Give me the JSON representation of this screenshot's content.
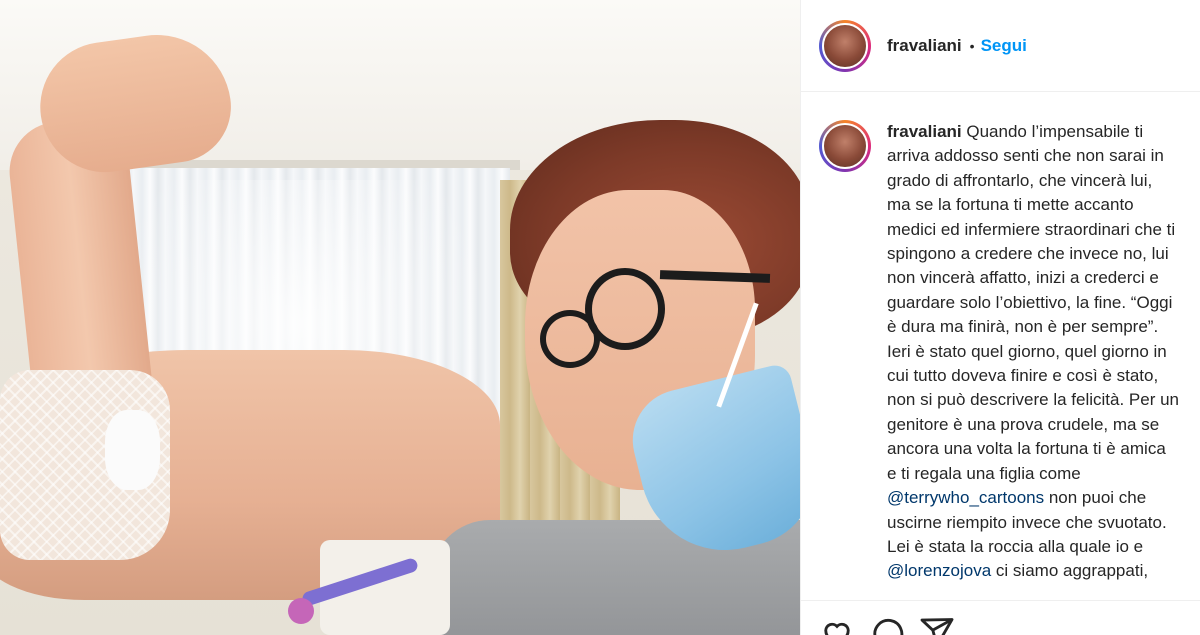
{
  "post": {
    "username": "fravaliani",
    "separator": "•",
    "follow_label": "Segui"
  },
  "caption": {
    "username": "fravaliani",
    "lines": [
      " Quando l’impensabile ti",
      "arriva addosso senti che non sarai in",
      "grado di affrontarlo, che vincerà lui,",
      "ma se la fortuna ti mette accanto",
      "medici ed infermiere straordinari che ti",
      "spingono a credere che invece no, lui",
      "non vincerà affatto, inizi a crederci e",
      "guardare solo l’obiettivo, la fine. “Oggi",
      "è dura ma finirà, non è per sempre”.",
      "Ieri è stato quel giorno, quel giorno in",
      "cui tutto doveva finire e così è stato,",
      "non si può descrivere la felicità. Per un",
      "genitore è una prova crudele, ma se",
      "ancora una volta la fortuna ti è amica",
      "e ti regala una figlia come"
    ],
    "mention_1": "@terrywho_cartoons",
    "line_after_mention_1": " non puoi che",
    "lines_2": [
      "uscirne riempito invece che svuotato.",
      "Lei è stata la roccia alla quale io e"
    ],
    "mention_2": "@lorenzojova",
    "line_after_mention_2": " ci siamo aggrappati,"
  },
  "actions": {
    "icons": [
      "heart-icon",
      "comment-icon",
      "share-icon"
    ]
  }
}
